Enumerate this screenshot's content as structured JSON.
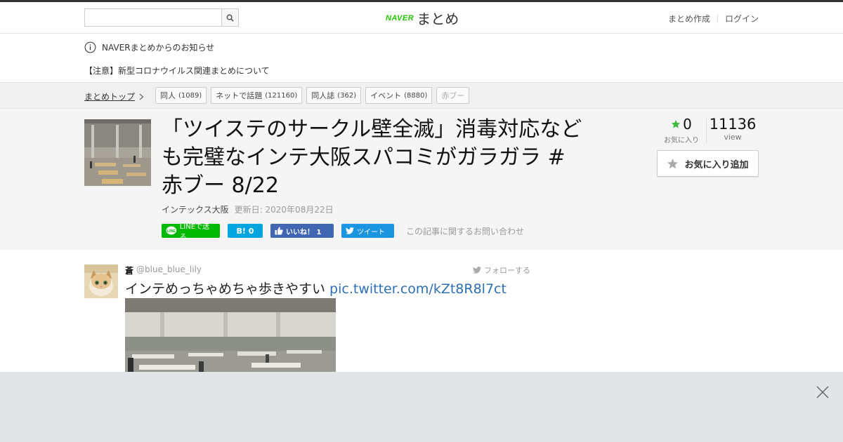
{
  "header": {
    "search_placeholder": "",
    "logo_brand": "NAVER",
    "logo_text": "まとめ",
    "nav": [
      "まとめ作成",
      "ログイン"
    ]
  },
  "notice": {
    "heading": "NAVERまとめからのお知らせ",
    "link": "【注意】新型コロナウイルス関連まとめについて"
  },
  "breadcrumb": {
    "top": "まとめトップ",
    "tags": [
      {
        "label": "同人",
        "count": "(1089)"
      },
      {
        "label": "ネットで話題",
        "count": "(121160)"
      },
      {
        "label": "同人誌",
        "count": "(362)"
      },
      {
        "label": "イベント",
        "count": "(8880)"
      },
      {
        "label": "赤ブー",
        "count": ""
      }
    ]
  },
  "article": {
    "title": "「ツイステのサークル壁全滅」消毒対応なども完璧なインテ大阪スパコミがガラガラ #赤ブー 8/22",
    "author": "インテックス大阪",
    "updated": "更新日: 2020年08月22日",
    "inquiry": "この記事に関するお問い合わせ"
  },
  "share": {
    "line": "LINEで送る",
    "hatena": "B! 0",
    "fb": "いいね！ 1",
    "tweet": "ツイート"
  },
  "stats": {
    "fav_count": "0",
    "fav_label": "お気に入り",
    "views": "11136",
    "views_label": "view",
    "fav_button": "お気に入り追加"
  },
  "tweet": {
    "name": "蒼",
    "handle": "@blue_blue_lily",
    "follow": "フォローする",
    "text": "インテめっちゃめちゃ歩きやすい ",
    "link": "pic.twitter.com/kZt8R8l7ct"
  },
  "colors": {
    "naver_green": "#1ec800",
    "line_green": "#00b900",
    "hatena_blue": "#00a4de",
    "fb_blue": "#4267b2",
    "twitter_blue": "#1b95e0",
    "star_green": "#3db83d",
    "link_blue": "#2c6fb4"
  }
}
